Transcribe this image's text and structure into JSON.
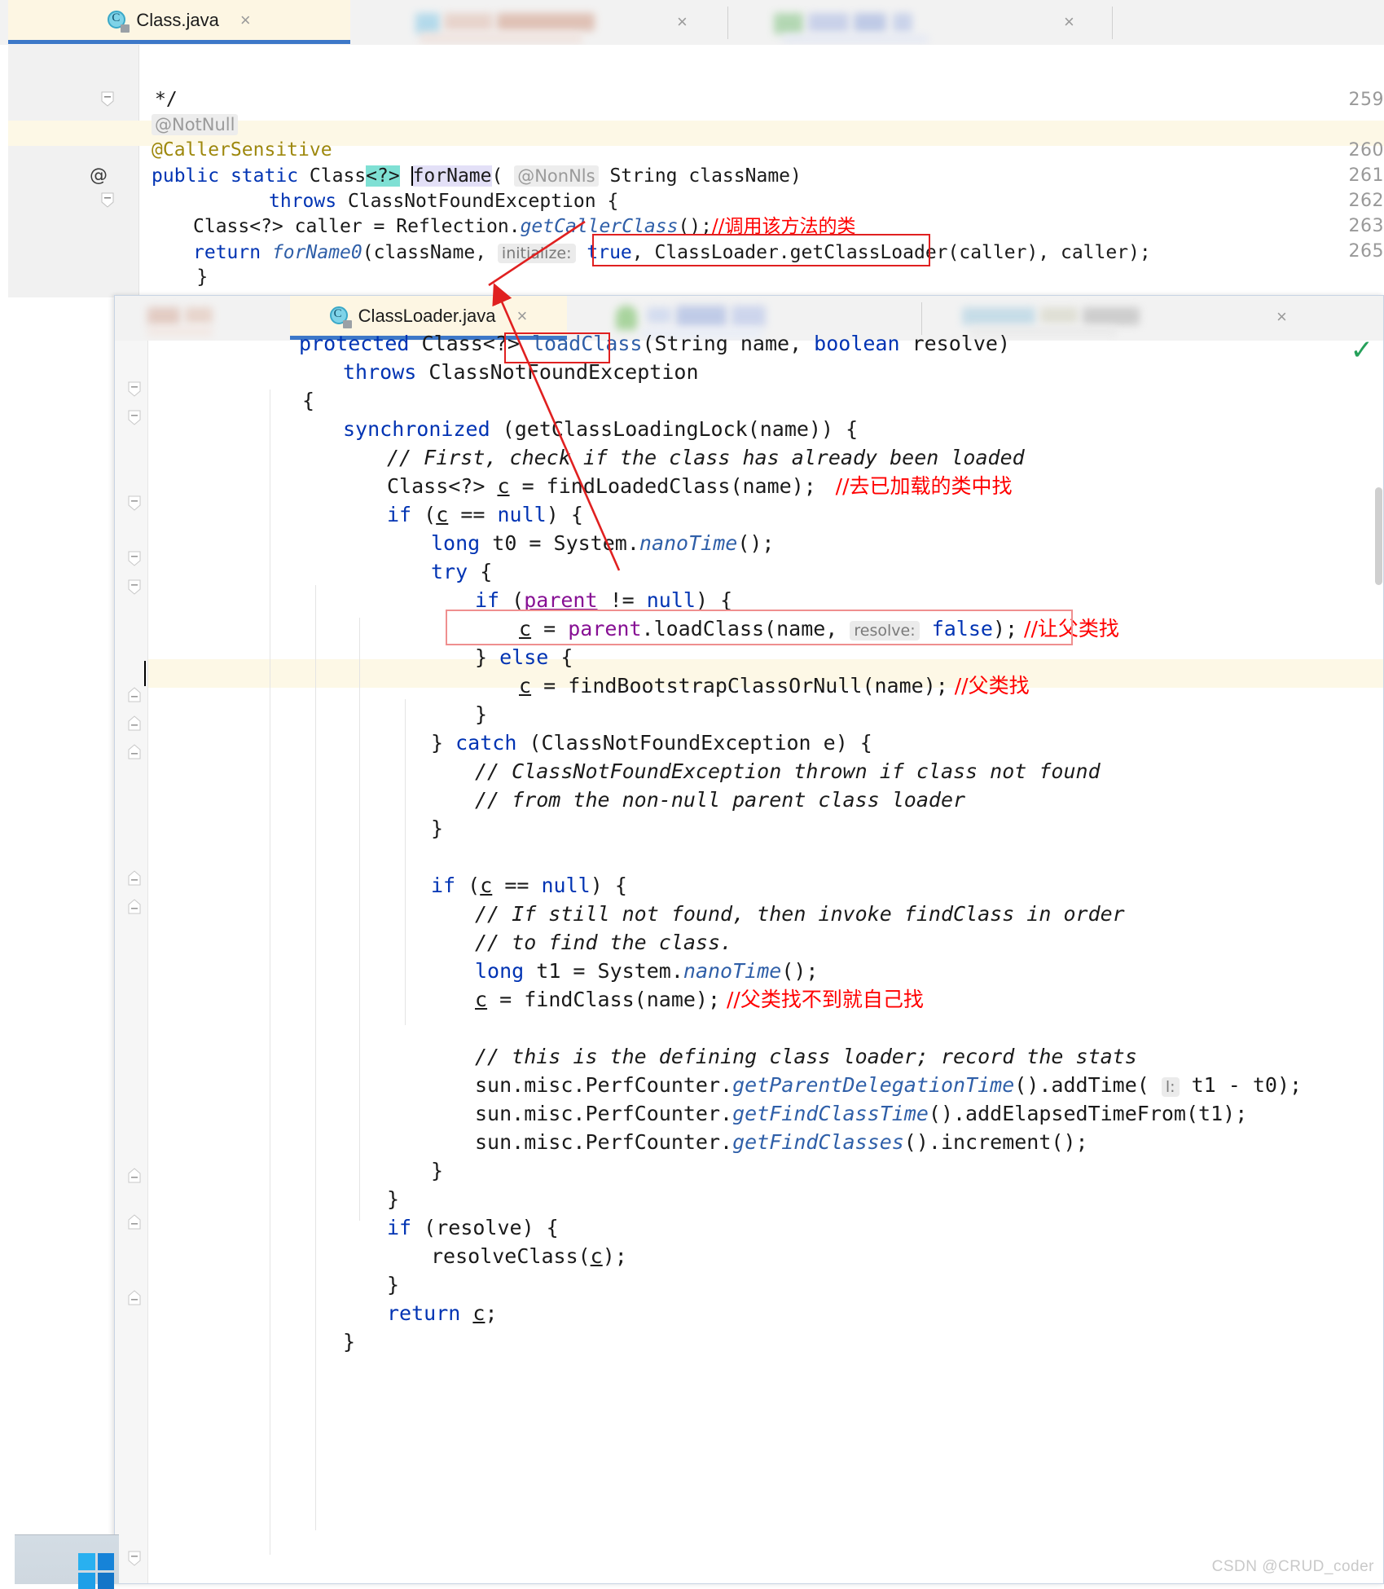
{
  "window_top": {
    "name": "Class.java editor window",
    "tab": {
      "label": "Class.java",
      "close": "×",
      "icon": "java-class-icon"
    },
    "gutter": {
      "lines": [
        "259",
        "260",
        "261",
        "262",
        "263",
        "265"
      ],
      "marker_at": "@"
    },
    "code": {
      "l259": "*/",
      "l259b_annotation": "@NotNull",
      "l260": "@CallerSensitive",
      "l261": {
        "kw_public": "public",
        "kw_static": "static",
        "type": "Class",
        "generic": "<?>",
        "method": "forName",
        "paren_open": "(",
        "param_anno": "@NonNls",
        "param_type": "String",
        "param_name": "className",
        "paren_close": ")"
      },
      "l262": {
        "kw_throws": "throws",
        "exception": "ClassNotFoundException",
        "brace": "{"
      },
      "l263": {
        "text": "Class<?> caller = Reflection.",
        "call": "getCallerClass",
        "tail": "();",
        "comment": "//调用该方法的类"
      },
      "l264": {
        "kw_return": "return",
        "call": "forName0",
        "arg1": "(className,",
        "hint": "initialize:",
        "val_true": "true",
        "comma": ",",
        "boxed": "ClassLoader.getClassLoader(caller)",
        "tail": ", caller);"
      }
    }
  },
  "window_bottom": {
    "name": "ClassLoader.java editor window",
    "tab": {
      "label": "ClassLoader.java",
      "close": "×",
      "icon": "java-class-icon"
    },
    "inspection_ok_icon": "green-checkmark-icon",
    "code_lines": [
      {
        "id": "sig",
        "indent": 2,
        "text": "protected Class<?> loadClass(String name, boolean resolve)"
      },
      {
        "id": "throws",
        "indent": 3,
        "text": "throws ClassNotFoundException"
      },
      {
        "id": "open",
        "indent": 1,
        "text": "{"
      },
      {
        "id": "sync",
        "indent": 2,
        "text": "synchronized (getClassLoadingLock(name)) {"
      },
      {
        "id": "c1",
        "indent": 3,
        "text": "// First, check if the class has already been loaded"
      },
      {
        "id": "c2",
        "indent": 3,
        "text": "Class<?> c = findLoadedClass(name);",
        "comment": "//去已加载的类中找"
      },
      {
        "id": "if1",
        "indent": 3,
        "text": "if (c == null) {"
      },
      {
        "id": "t0",
        "indent": 4,
        "text": "long t0 = System.nanoTime();"
      },
      {
        "id": "try",
        "indent": 4,
        "text": "try {"
      },
      {
        "id": "if2",
        "indent": 5,
        "text": "if (parent != null) {"
      },
      {
        "id": "pl",
        "indent": 6,
        "text": "c = parent.loadClass(name,  resolve: false);",
        "comment": "//让父类找"
      },
      {
        "id": "else",
        "indent": 5,
        "text": "} else {"
      },
      {
        "id": "boot",
        "indent": 6,
        "text": "c = findBootstrapClassOrNull(name);",
        "comment": "//父类找"
      },
      {
        "id": "close1",
        "indent": 5,
        "text": "}"
      },
      {
        "id": "catch",
        "indent": 4,
        "text": "} catch (ClassNotFoundException e) {"
      },
      {
        "id": "c3",
        "indent": 5,
        "text": "// ClassNotFoundException thrown if class not found"
      },
      {
        "id": "c4",
        "indent": 5,
        "text": "// from the non-null parent class loader"
      },
      {
        "id": "close2",
        "indent": 4,
        "text": "}"
      },
      {
        "id": "blank1",
        "indent": 0,
        "text": ""
      },
      {
        "id": "if3",
        "indent": 4,
        "text": "if (c == null) {"
      },
      {
        "id": "c5",
        "indent": 5,
        "text": "// If still not found, then invoke findClass in order"
      },
      {
        "id": "c6",
        "indent": 5,
        "text": "// to find the class."
      },
      {
        "id": "t1",
        "indent": 5,
        "text": "long t1 = System.nanoTime();"
      },
      {
        "id": "fc",
        "indent": 5,
        "text": "c = findClass(name);",
        "comment": "//父类找不到就自己找"
      },
      {
        "id": "blank2",
        "indent": 0,
        "text": ""
      },
      {
        "id": "c7",
        "indent": 5,
        "text": "// this is the defining class loader; record the stats"
      },
      {
        "id": "p1",
        "indent": 5,
        "text": "sun.misc.PerfCounter.getParentDelegationTime().addTime( l: t1 - t0);"
      },
      {
        "id": "p2",
        "indent": 5,
        "text": "sun.misc.PerfCounter.getFindClassTime().addElapsedTimeFrom(t1);"
      },
      {
        "id": "p3",
        "indent": 5,
        "text": "sun.misc.PerfCounter.getFindClasses().increment();"
      },
      {
        "id": "close3",
        "indent": 4,
        "text": "}"
      },
      {
        "id": "close4",
        "indent": 3,
        "text": "}"
      },
      {
        "id": "ifres",
        "indent": 3,
        "text": "if (resolve) {"
      },
      {
        "id": "resolve",
        "indent": 4,
        "text": "resolveClass(c);"
      },
      {
        "id": "close5",
        "indent": 3,
        "text": "}"
      },
      {
        "id": "ret",
        "indent": 3,
        "text": "return c;"
      },
      {
        "id": "close6",
        "indent": 2,
        "text": "}"
      }
    ]
  },
  "annotations": {
    "boxes": [
      {
        "name": "getclassloader-call-box",
        "label": "ClassLoader.getClassLoader(caller)"
      },
      {
        "name": "loadclass-method-box",
        "label": "loadClass"
      },
      {
        "name": "parent-loadclass-box",
        "label": "parent.loadClass(name, resolve: false);"
      }
    ],
    "red_comments": [
      "//调用该方法的类",
      "//去已加载的类中找",
      "//让父类找",
      "//父类找",
      "//父类找不到就自己找"
    ],
    "arrow_color": "#e02020"
  },
  "watermark": {
    "text": "CSDN @CRUD_coder"
  },
  "taskbar": {
    "logo": "windows-logo-icon"
  },
  "colors": {
    "keyword": "#0033b3",
    "annotation": "#9e880d",
    "comment": "#a0a0a0",
    "red": "#ff0000",
    "field": "#871094",
    "tab_active_bg": "#fdf6e3",
    "tab_active_underline": "#3d78c8",
    "current_line_bg": "#fdf8e6"
  }
}
